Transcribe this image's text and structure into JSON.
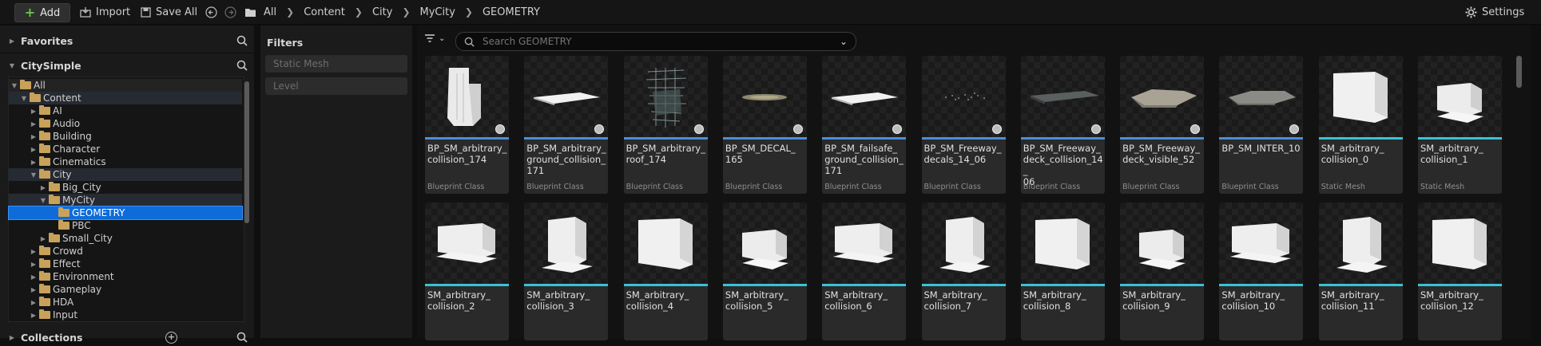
{
  "toolbar": {
    "add": "Add",
    "import": "Import",
    "save_all": "Save All",
    "breadcrumb": [
      "All",
      "Content",
      "City",
      "MyCity",
      "GEOMETRY"
    ],
    "settings": "Settings"
  },
  "left": {
    "favorites": "Favorites",
    "project": "CitySimple",
    "collections": "Collections",
    "tree": [
      {
        "label": "All",
        "depth": 0,
        "expanded": true
      },
      {
        "label": "Content",
        "depth": 1,
        "expanded": true
      },
      {
        "label": "AI",
        "depth": 2
      },
      {
        "label": "Audio",
        "depth": 2
      },
      {
        "label": "Building",
        "depth": 2
      },
      {
        "label": "Character",
        "depth": 2
      },
      {
        "label": "Cinematics",
        "depth": 2
      },
      {
        "label": "City",
        "depth": 2,
        "expanded": true
      },
      {
        "label": "Big_City",
        "depth": 3
      },
      {
        "label": "MyCity",
        "depth": 3,
        "expanded": true
      },
      {
        "label": "GEOMETRY",
        "depth": 4,
        "selected": true
      },
      {
        "label": "PBC",
        "depth": 4
      },
      {
        "label": "Small_City",
        "depth": 3
      },
      {
        "label": "Crowd",
        "depth": 2
      },
      {
        "label": "Effect",
        "depth": 2
      },
      {
        "label": "Environment",
        "depth": 2
      },
      {
        "label": "Gameplay",
        "depth": 2
      },
      {
        "label": "HDA",
        "depth": 2
      },
      {
        "label": "Input",
        "depth": 2
      }
    ]
  },
  "filters": {
    "title": "Filters",
    "items": [
      "Static Mesh",
      "Level"
    ]
  },
  "search": {
    "placeholder": "Search GEOMETRY"
  },
  "assets": [
    {
      "name": "BP_SM_arbitrary_collision_174",
      "type": "Blueprint Class",
      "kind": "tower",
      "accent": "#4a8fd8"
    },
    {
      "name": "BP_SM_arbitrary_ground_collision_171",
      "type": "Blueprint Class",
      "kind": "slab",
      "accent": "#4a8fd8"
    },
    {
      "name": "BP_SM_arbitrary_roof_174",
      "type": "Blueprint Class",
      "kind": "wire",
      "accent": "#4a8fd8"
    },
    {
      "name": "BP_SM_DECAL_165",
      "type": "Blueprint Class",
      "kind": "decal",
      "accent": "#4a8fd8"
    },
    {
      "name": "BP_SM_failsafe_ground_collision_171",
      "type": "Blueprint Class",
      "kind": "slab",
      "accent": "#4a8fd8"
    },
    {
      "name": "BP_SM_Freeway_decals_14_06",
      "type": "Blueprint Class",
      "kind": "dots",
      "accent": "#4a8fd8"
    },
    {
      "name": "BP_SM_Freeway_deck_collision_14_06",
      "type": "Blueprint Class",
      "kind": "darkslab",
      "accent": "#4a8fd8"
    },
    {
      "name": "BP_SM_Freeway_deck_visible_52",
      "type": "Blueprint Class",
      "kind": "rock",
      "accent": "#4a8fd8"
    },
    {
      "name": "BP_SM_INTER_10",
      "type": "Blueprint Class",
      "kind": "greyslab",
      "accent": "#4a8fd8"
    },
    {
      "name": "SM_arbitrary_collision_0",
      "type": "Static Mesh",
      "kind": "block",
      "accent": "#39c2d7"
    },
    {
      "name": "SM_arbitrary_collision_1",
      "type": "Static Mesh",
      "kind": "block",
      "accent": "#39c2d7"
    },
    {
      "name": "SM_arbitrary_collision_2",
      "type": "",
      "kind": "block",
      "accent": "#39c2d7"
    },
    {
      "name": "SM_arbitrary_collision_3",
      "type": "",
      "kind": "block",
      "accent": "#39c2d7"
    },
    {
      "name": "SM_arbitrary_collision_4",
      "type": "",
      "kind": "block",
      "accent": "#39c2d7"
    },
    {
      "name": "SM_arbitrary_collision_5",
      "type": "",
      "kind": "block",
      "accent": "#39c2d7"
    },
    {
      "name": "SM_arbitrary_collision_6",
      "type": "",
      "kind": "block",
      "accent": "#39c2d7"
    },
    {
      "name": "SM_arbitrary_collision_7",
      "type": "",
      "kind": "block",
      "accent": "#39c2d7"
    },
    {
      "name": "SM_arbitrary_collision_8",
      "type": "",
      "kind": "block",
      "accent": "#39c2d7"
    },
    {
      "name": "SM_arbitrary_collision_9",
      "type": "",
      "kind": "block",
      "accent": "#39c2d7"
    },
    {
      "name": "SM_arbitrary_collision_10",
      "type": "",
      "kind": "block",
      "accent": "#39c2d7"
    },
    {
      "name": "SM_arbitrary_collision_11",
      "type": "",
      "kind": "block",
      "accent": "#39c2d7"
    },
    {
      "name": "SM_arbitrary_collision_12",
      "type": "",
      "kind": "block",
      "accent": "#39c2d7"
    }
  ],
  "asset_name_lines": [
    [
      "BP_SM_arbitrary_",
      "collision_174"
    ],
    [
      "BP_SM_arbitrary_",
      "ground_collision_",
      "171"
    ],
    [
      "BP_SM_arbitrary_",
      "roof_174"
    ],
    [
      "BP_SM_DECAL_",
      "165"
    ],
    [
      "BP_SM_failsafe_",
      "ground_collision_",
      "171"
    ],
    [
      "BP_SM_Freeway_",
      "decals_14_06"
    ],
    [
      "BP_SM_Freeway_",
      "deck_collision_14_",
      "06"
    ],
    [
      "BP_SM_Freeway_",
      "deck_visible_52"
    ],
    [
      "BP_SM_INTER_10"
    ],
    [
      "SM_arbitrary_",
      "collision_0"
    ],
    [
      "SM_arbitrary_",
      "collision_1"
    ],
    [
      "SM_arbitrary_",
      "collision_2"
    ],
    [
      "SM_arbitrary_",
      "collision_3"
    ],
    [
      "SM_arbitrary_",
      "collision_4"
    ],
    [
      "SM_arbitrary_",
      "collision_5"
    ],
    [
      "SM_arbitrary_",
      "collision_6"
    ],
    [
      "SM_arbitrary_",
      "collision_7"
    ],
    [
      "SM_arbitrary_",
      "collision_8"
    ],
    [
      "SM_arbitrary_",
      "collision_9"
    ],
    [
      "SM_arbitrary_",
      "collision_10"
    ],
    [
      "SM_arbitrary_",
      "collision_11"
    ],
    [
      "SM_arbitrary_",
      "collision_12"
    ]
  ]
}
